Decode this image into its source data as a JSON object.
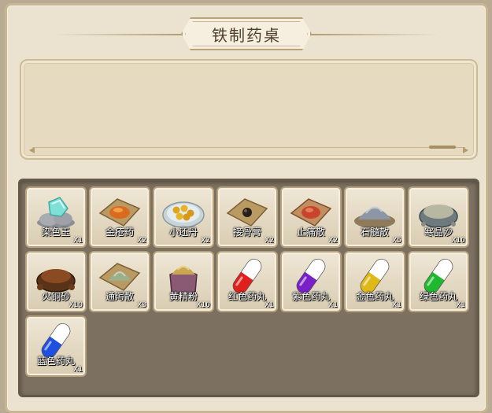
{
  "title": "铁制药桌",
  "description": "",
  "colors": {
    "panel_bg": "#ebe2cf",
    "inventory_bg": "#7c7060",
    "slot_bg": "#efe7d6",
    "title_text": "#4e3f2c"
  },
  "items": [
    {
      "name": "染色玉",
      "count": "X1",
      "icon": "jade-stone-icon"
    },
    {
      "name": "金疮药",
      "count": "X2",
      "icon": "orange-powder-paper-icon"
    },
    {
      "name": "小还丹",
      "count": "X2",
      "icon": "golden-pills-bowl-icon"
    },
    {
      "name": "接骨膏",
      "count": "X2",
      "icon": "black-pill-paper-icon"
    },
    {
      "name": "止痛散",
      "count": "X2",
      "icon": "red-powder-paper-icon"
    },
    {
      "name": "石髓散",
      "count": "X5",
      "icon": "grey-powder-pile-icon"
    },
    {
      "name": "寒晶沙",
      "count": "X10",
      "icon": "sand-bowl-icon"
    },
    {
      "name": "火铜砂",
      "count": "X10",
      "icon": "copper-sand-bowl-icon"
    },
    {
      "name": "通泻散",
      "count": "X3",
      "icon": "green-powder-paper-icon"
    },
    {
      "name": "黄精粉",
      "count": "X10",
      "icon": "yellow-powder-jar-icon"
    },
    {
      "name": "红色药丸",
      "count": "X1",
      "icon": "red-capsule-icon",
      "color": "#e0201c"
    },
    {
      "name": "紫色药丸",
      "count": "X1",
      "icon": "purple-capsule-icon",
      "color": "#7a20c8"
    },
    {
      "name": "金色药丸",
      "count": "X1",
      "icon": "gold-capsule-icon",
      "color": "#e0b818"
    },
    {
      "name": "绿色药丸",
      "count": "X1",
      "icon": "green-capsule-icon",
      "color": "#20b830"
    },
    {
      "name": "蓝色药丸",
      "count": "X1",
      "icon": "blue-capsule-icon",
      "color": "#2050e0"
    }
  ]
}
